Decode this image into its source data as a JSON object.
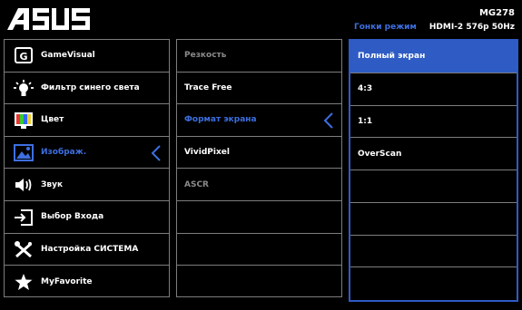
{
  "brand": "ASUS",
  "header": {
    "model": "MG278",
    "mode": "Гонки режим",
    "signal": "HDMI-2  576p 50Hz"
  },
  "menu": [
    {
      "label": "GameVisual",
      "icon": "gamevisual-icon"
    },
    {
      "label": "Фильтр синего света",
      "icon": "bluelight-icon"
    },
    {
      "label": "Цвет",
      "icon": "color-icon"
    },
    {
      "label": "Изображ.",
      "icon": "image-icon",
      "active": true
    },
    {
      "label": "Звук",
      "icon": "speaker-icon"
    },
    {
      "label": "Выбор Входа",
      "icon": "input-icon"
    },
    {
      "label": "Настройка СИСТЕМА",
      "icon": "wrench-icon"
    },
    {
      "label": "MyFavorite",
      "icon": "star-icon"
    }
  ],
  "submenu": [
    {
      "label": "Резкость",
      "state": "disabled"
    },
    {
      "label": "Trace Free",
      "state": "normal"
    },
    {
      "label": "Формат экрана",
      "state": "active"
    },
    {
      "label": "VividPixel",
      "state": "normal"
    },
    {
      "label": "ASCR",
      "state": "disabled"
    },
    {
      "label": "",
      "state": "empty"
    },
    {
      "label": "",
      "state": "empty"
    },
    {
      "label": "",
      "state": "empty"
    }
  ],
  "options": [
    {
      "label": "Полный экран",
      "selected": true
    },
    {
      "label": "4:3"
    },
    {
      "label": "1:1"
    },
    {
      "label": "OverScan"
    },
    {
      "label": ""
    },
    {
      "label": ""
    },
    {
      "label": ""
    },
    {
      "label": ""
    }
  ],
  "colors": {
    "accent": "#2f5bc4",
    "active_text": "#3d6fe0",
    "border": "#7d7d7d"
  }
}
